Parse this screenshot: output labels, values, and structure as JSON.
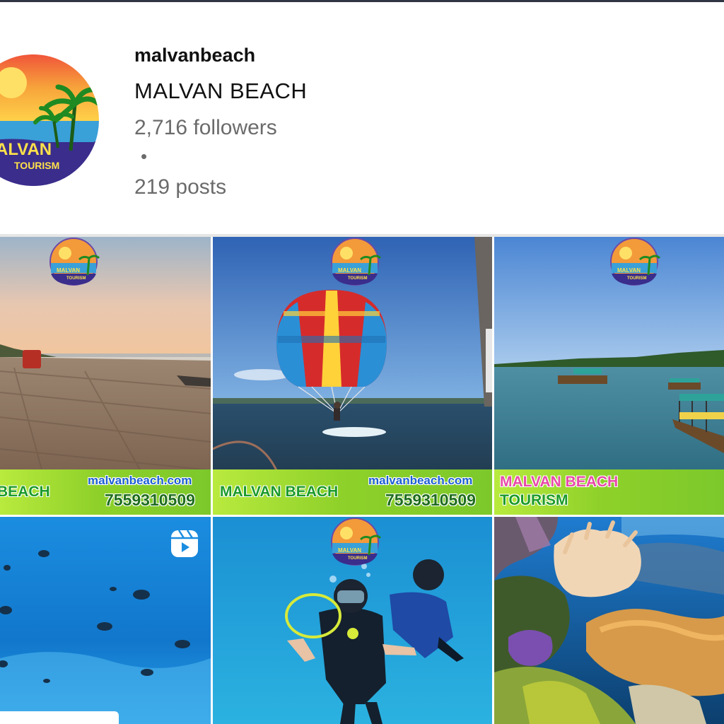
{
  "profile": {
    "username": "malvanbeach",
    "full_name": "MALVAN BEACH",
    "followers": "2,716 followers",
    "separator": "•",
    "posts": "219 posts",
    "avatar_text_1": "ALVAN",
    "avatar_text_2": "TOURISM"
  },
  "logo": {
    "line_1": "MALVAN",
    "line_2": "TOURISM"
  },
  "posts_grid": [
    {
      "scene": "beach-sunset",
      "banner_name": "BEACH",
      "banner_url": "malvanbeach.com",
      "banner_phone": "7559310509"
    },
    {
      "scene": "parasailing",
      "banner_name": "MALVAN BEACH",
      "banner_url": "malvanbeach.com",
      "banner_phone": "7559310509"
    },
    {
      "scene": "boats-bay",
      "banner_line_1": "MALVAN BEACH",
      "banner_line_2": "TOURISM"
    },
    {
      "scene": "underwater-fish",
      "type": "reel"
    },
    {
      "scene": "scuba-divers"
    },
    {
      "scene": "coral-reef"
    }
  ],
  "colors": {
    "banner_green": "#8fd12a",
    "url_blue": "#1d5fd3",
    "pink": "#e84aa8",
    "muted_text": "#6b6b6b"
  }
}
